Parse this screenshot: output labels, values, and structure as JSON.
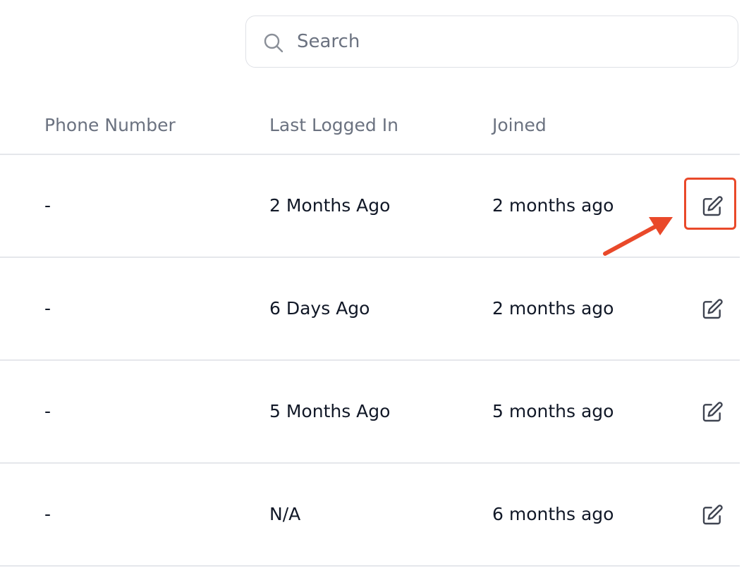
{
  "search": {
    "placeholder": "Search",
    "icon": "search-icon"
  },
  "table": {
    "headers": {
      "phone": "Phone Number",
      "last_logged_in": "Last Logged In",
      "joined": "Joined"
    },
    "rows": [
      {
        "phone": "-",
        "last_logged_in": "2 Months Ago",
        "joined": "2 months ago",
        "action_icon": "edit-icon"
      },
      {
        "phone": "-",
        "last_logged_in": "6 Days Ago",
        "joined": "2 months ago",
        "action_icon": "edit-icon"
      },
      {
        "phone": "-",
        "last_logged_in": "5 Months Ago",
        "joined": "5 months ago",
        "action_icon": "edit-icon"
      },
      {
        "phone": "-",
        "last_logged_in": "N/A",
        "joined": "6 months ago",
        "action_icon": "edit-icon"
      }
    ]
  },
  "annotation": {
    "color": "#e9492a",
    "target": "row 1 edit button"
  },
  "colors": {
    "header_text": "#6b7280",
    "body_text": "#111827",
    "border": "#e5e7eb",
    "icon": "#3f4451"
  }
}
